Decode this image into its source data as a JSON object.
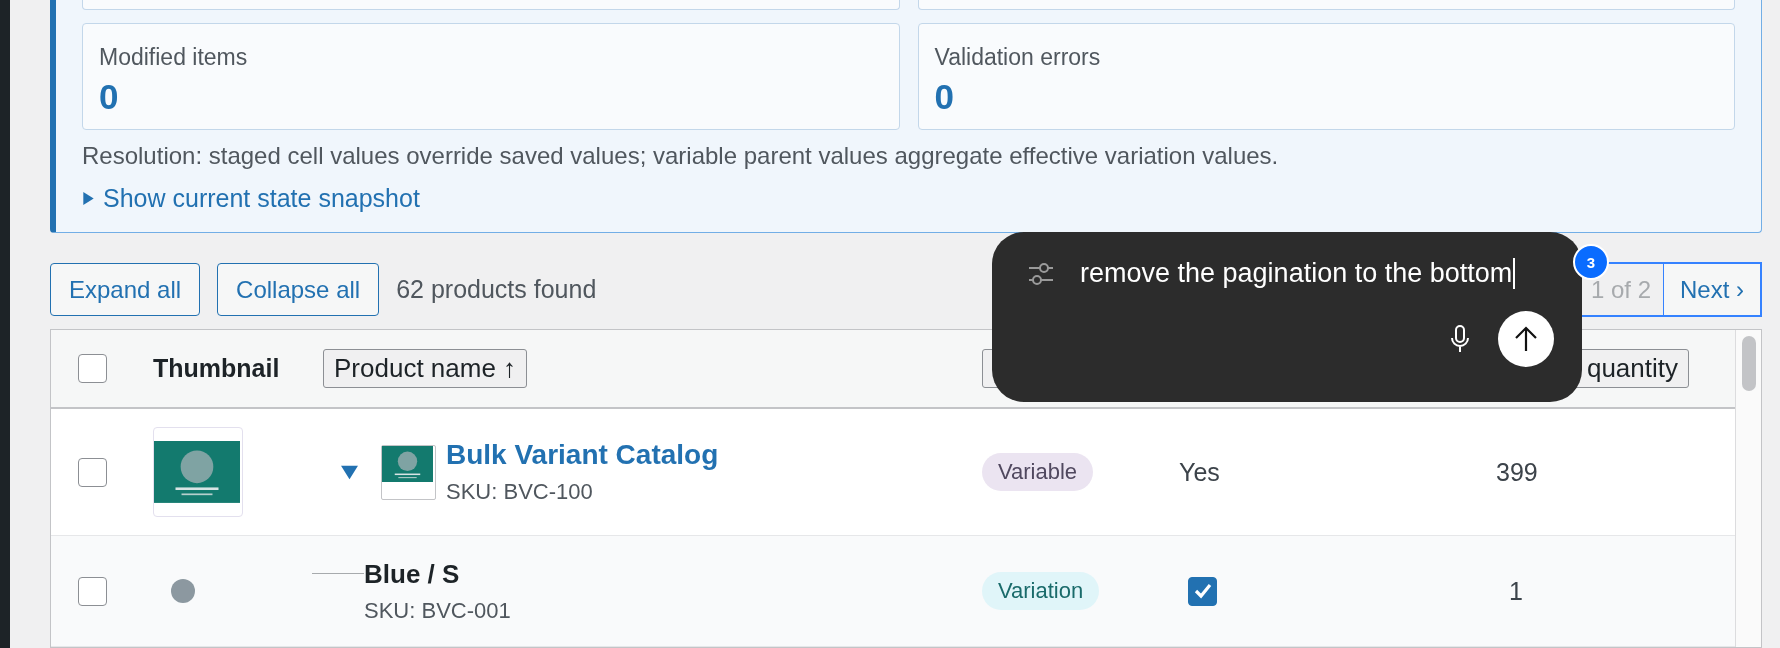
{
  "summary": {
    "cards": [
      {
        "label": "Modified items",
        "value": "0"
      },
      {
        "label": "Validation errors",
        "value": "0"
      }
    ],
    "note": "Resolution: staged cell values override saved values; variable parent values aggregate effective variation values.",
    "snapshot": {
      "label": "Show current state snapshot",
      "expanded": false
    }
  },
  "toolbar": {
    "buttons": [
      "Expand all",
      "Collapse all"
    ],
    "count": "62 products found",
    "pagination": {
      "page": "1 of 2",
      "next": "Next ›",
      "focused": true,
      "badge": "3"
    }
  },
  "table": {
    "select_all": {
      "checked": false
    },
    "columns": [
      {
        "kind": "text",
        "label": "Thumbnail"
      },
      {
        "kind": "sort",
        "label": "Product name ↑"
      },
      {
        "kind": "sort"
      },
      {
        "kind": "sort",
        "label": "quantity"
      }
    ],
    "rows": [
      {
        "kind": "parent",
        "checked": false,
        "expanded": true,
        "name": "Bulk Variant Catalog",
        "sku": "SKU: BVC-100",
        "type": "Variable",
        "featured": "Yes",
        "stock": "399"
      },
      {
        "kind": "variation",
        "checked": false,
        "name": "Blue / S",
        "sku": "SKU: BVC-001",
        "type": "Variation",
        "featured_checked": true,
        "stock": "1"
      }
    ]
  },
  "prompt": {
    "text": "remove the pagination to the bottom"
  }
}
